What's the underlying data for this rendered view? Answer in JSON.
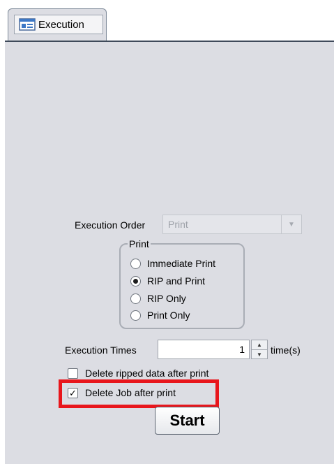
{
  "tab": {
    "label": "Execution",
    "icon": "printer-icon"
  },
  "execution_order": {
    "label": "Execution Order",
    "value": "Print",
    "disabled": true
  },
  "print_group": {
    "legend": "Print",
    "options": [
      {
        "label": "Immediate Print",
        "selected": false
      },
      {
        "label": "RIP and Print",
        "selected": true
      },
      {
        "label": "RIP Only",
        "selected": false
      },
      {
        "label": "Print Only",
        "selected": false
      }
    ]
  },
  "execution_times": {
    "label": "Execution Times",
    "value": "1",
    "unit": "time(s)"
  },
  "checkboxes": {
    "delete_ripped": {
      "label": "Delete ripped data after print",
      "checked": false
    },
    "delete_job": {
      "label": "Delete Job after print",
      "checked": true
    }
  },
  "start_label": "Start",
  "colors": {
    "panel": "#dcdde3",
    "highlight": "#e8161c"
  }
}
